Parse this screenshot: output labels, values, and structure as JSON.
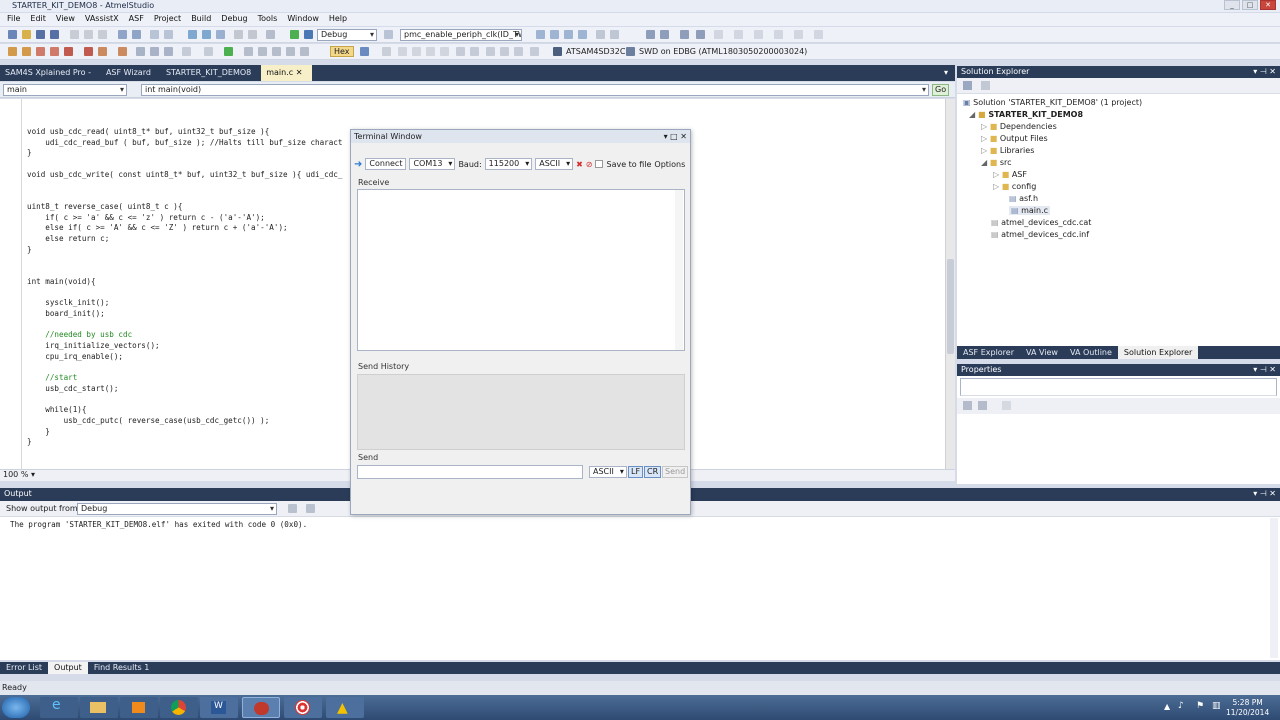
{
  "window": {
    "title": "STARTER_KIT_DEMO8 - AtmelStudio"
  },
  "menu": [
    "File",
    "Edit",
    "View",
    "VAssistX",
    "ASF",
    "Project",
    "Build",
    "Debug",
    "Tools",
    "Window",
    "Help"
  ],
  "toolbar": {
    "config": "Debug",
    "function_combo": "pmc_enable_periph_clk(ID_TWI",
    "hex_label": "Hex",
    "device": "ATSAM4SD32C",
    "tool": "SWD on EDBG (ATML1803050200003024)"
  },
  "doc_tabs": [
    "SAM4S Xplained Pro -",
    "ASF Wizard",
    "STARTER_KIT_DEMO8",
    "main.c"
  ],
  "nav": {
    "scope": "main",
    "member": "int main(void)",
    "go_label": "Go"
  },
  "code_lines": [
    "void usb_cdc_read( uint8_t* buf, uint32_t buf_size ){",
    "    udi_cdc_read_buf ( buf, buf_size ); //Halts till buf_size charact",
    "}",
    "",
    "void usb_cdc_write( const uint8_t* buf, uint32_t buf_size ){ udi_cdc_",
    "",
    "",
    "uint8_t reverse_case( uint8_t c ){",
    "    if( c >= 'a' && c <= 'z' ) return c - ('a'-'A');",
    "    else if( c >= 'A' && c <= 'Z' ) return c + ('a'-'A');",
    "    else return c;",
    "}",
    "",
    "",
    "int main(void){",
    "",
    "    sysclk_init();",
    "    board_init();",
    "",
    "    //needed by usb cdc",
    "    irq_initialize_vectors();",
    "    cpu_irq_enable();",
    "",
    "    //start",
    "    usb_cdc_start();",
    "",
    "    while(1){",
    "        usb_cdc_putc( reverse_case(usb_cdc_getc()) );",
    "    }",
    "}"
  ],
  "zoom": "100 %",
  "terminal": {
    "title": "Terminal Window",
    "connect": "Connect",
    "port": "COM13",
    "baud_label": "Baud:",
    "baud": "115200",
    "mode": "ASCII",
    "save_to_file": "Save to file",
    "options": "Options",
    "receive_label": "Receive",
    "send_history_label": "Send History",
    "send_label": "Send",
    "send_mode": "ASCII",
    "lf": "LF",
    "cr": "CR",
    "send_button": "Send"
  },
  "solution_explorer": {
    "title": "Solution Explorer",
    "items": [
      "Solution 'STARTER_KIT_DEMO8' (1 project)",
      "STARTER_KIT_DEMO8",
      "Dependencies",
      "Output Files",
      "Libraries",
      "src",
      "ASF",
      "config",
      "asf.h",
      "main.c",
      "atmel_devices_cdc.cat",
      "atmel_devices_cdc.inf"
    ]
  },
  "side_tabs": [
    "ASF Explorer",
    "VA View",
    "VA Outline",
    "Solution Explorer"
  ],
  "properties": {
    "title": "Properties"
  },
  "output": {
    "title": "Output",
    "show_from_label": "Show output from:",
    "source": "Debug",
    "text": "The program 'STARTER_KIT_DEMO8.elf' has exited with code 0 (0x0)."
  },
  "output_tabs": [
    "Error List",
    "Output",
    "Find Results 1"
  ],
  "status": {
    "text": "Ready"
  },
  "clock": {
    "time": "5:28 PM",
    "date": "11/20/2014"
  },
  "colors": {
    "ide_blue": "#2b3c59",
    "active_tab": "#f7efc8",
    "keyword": "#0000c8",
    "comment": "#248a24"
  }
}
